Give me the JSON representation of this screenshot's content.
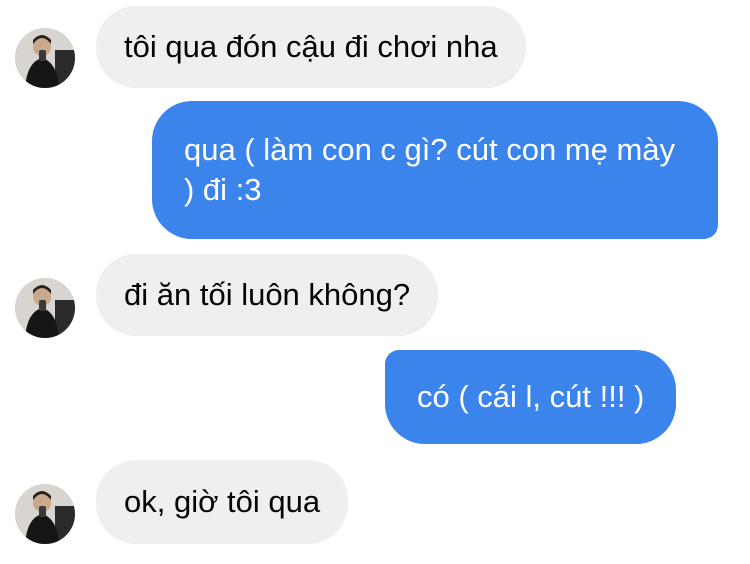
{
  "messages": [
    {
      "from": "contact",
      "text": "tôi qua đón cậu đi chơi nha"
    },
    {
      "from": "me",
      "text": "qua ( làm con c gì? cút con mẹ mày ) đi :3"
    },
    {
      "from": "contact",
      "text": "đi ăn tối luôn không?"
    },
    {
      "from": "me",
      "text": "có ( cái l, cút !!! )"
    },
    {
      "from": "contact",
      "text": "ok, giờ tôi qua"
    }
  ],
  "colors": {
    "incoming_bubble": "#efefef",
    "outgoing_bubble": "#3b84ec",
    "incoming_text": "#050505",
    "outgoing_text": "#ffffff"
  }
}
